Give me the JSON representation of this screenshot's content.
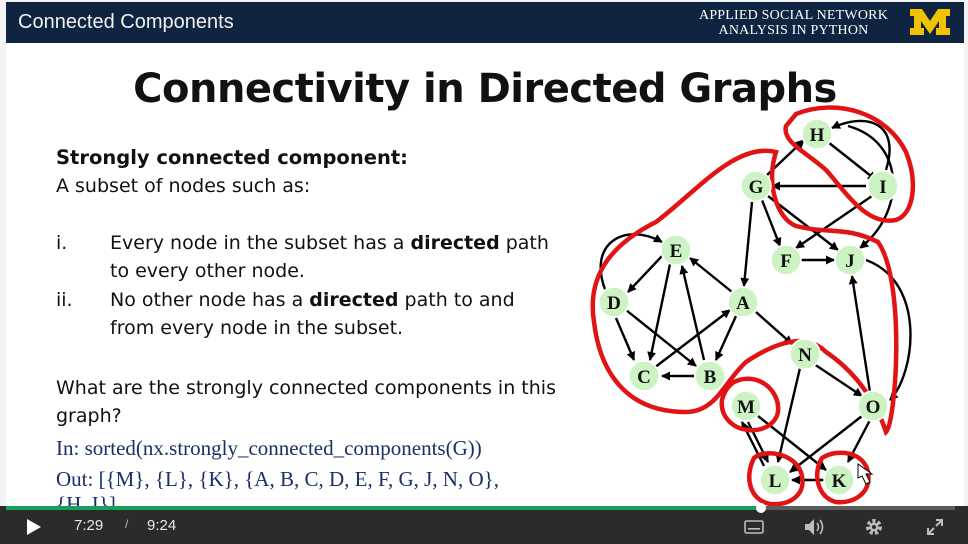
{
  "header": {
    "course_title": "Connected Components",
    "brand_line1": "APPLIED SOCIAL NETWORK",
    "brand_line2": "ANALYSIS IN PYTHON",
    "logo_color": "#f2c200"
  },
  "slide": {
    "title": "Connectivity in Directed Graphs",
    "scc_label": "Strongly connected component:",
    "scc_definition": "A subset of nodes such as:",
    "items": [
      {
        "num": "i.",
        "pre": "Every node in the subset has a ",
        "bold": "directed",
        "post": " path",
        "line2": "to every other node."
      },
      {
        "num": "ii.",
        "pre": "No other node has a ",
        "bold": "directed",
        "post": " path to and",
        "line2": "from every node in the subset."
      }
    ],
    "question_line1": "What are the strongly connected components in this",
    "question_line2": "graph?",
    "code_in": "In: sorted(nx.strongly_connected_components(G))",
    "code_out": "Out: [{M}, {L}, {K}, {A, B, C, D, E, F, G, J, N, O},",
    "code_out2": "{H, I}]"
  },
  "graph": {
    "node_fill": "#cdf3c4",
    "edge_color": "#000000",
    "highlight_color": "#e01414",
    "nodes": [
      "H",
      "I",
      "G",
      "F",
      "J",
      "E",
      "D",
      "A",
      "N",
      "C",
      "B",
      "M",
      "O",
      "L",
      "K"
    ]
  },
  "player": {
    "current_time": "7:29",
    "separator": "/",
    "duration": "9:24",
    "progress": 0.796,
    "progress_color": "#18a05a",
    "icons": [
      "play-icon",
      "captions-icon",
      "volume-icon",
      "settings-icon",
      "fullscreen-icon"
    ]
  }
}
